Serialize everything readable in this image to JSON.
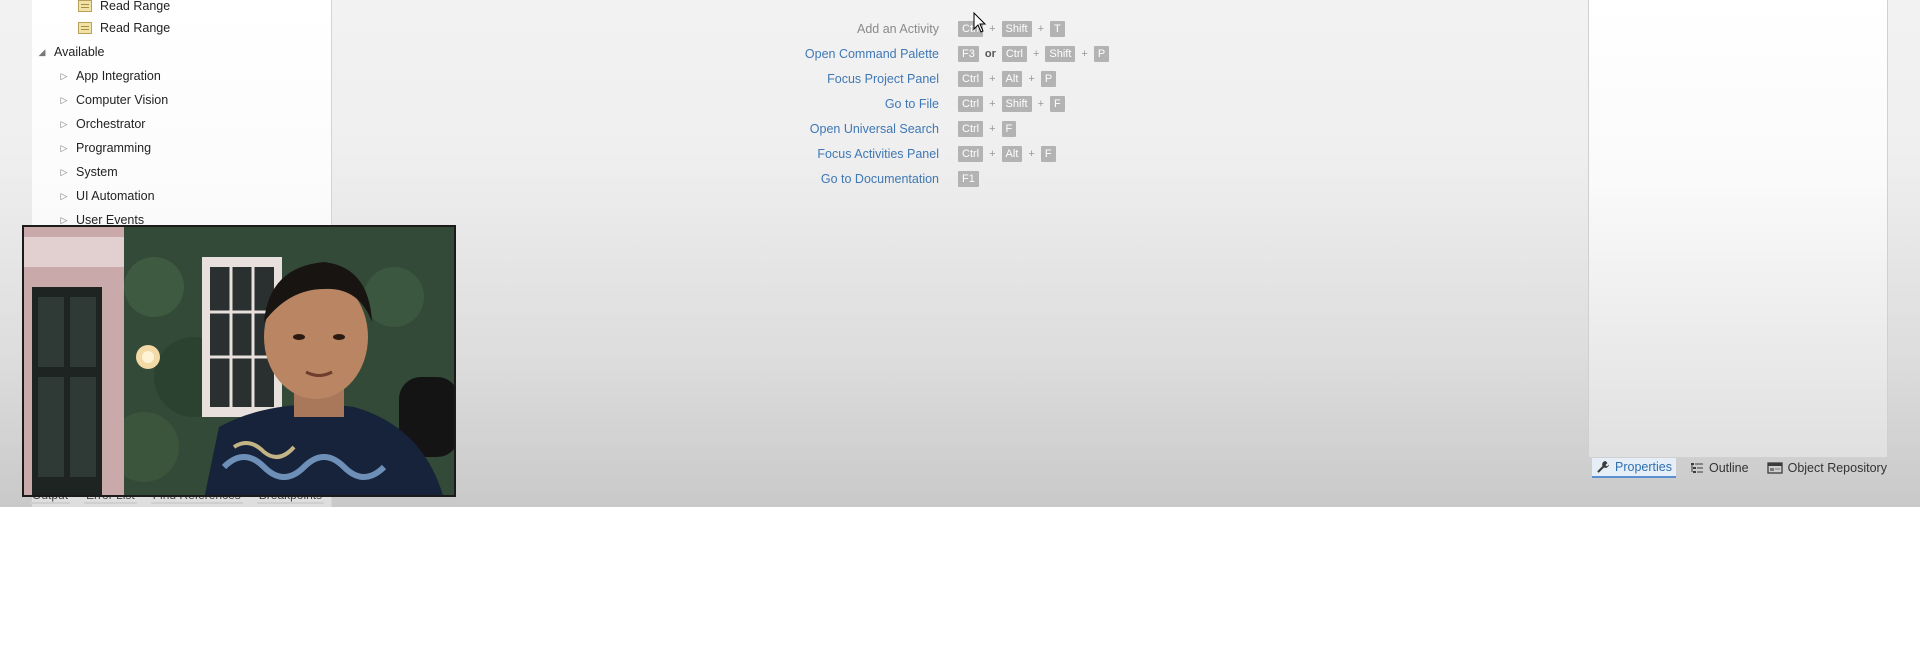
{
  "tree": {
    "items": [
      {
        "label": "Read Range",
        "kind": "activity"
      },
      {
        "label": "Read Range",
        "kind": "activity"
      },
      {
        "label": "Available",
        "kind": "group-expanded"
      },
      {
        "label": "App Integration",
        "kind": "category"
      },
      {
        "label": "Computer Vision",
        "kind": "category"
      },
      {
        "label": "Orchestrator",
        "kind": "category"
      },
      {
        "label": "Programming",
        "kind": "category"
      },
      {
        "label": "System",
        "kind": "category"
      },
      {
        "label": "UI Automation",
        "kind": "category"
      },
      {
        "label": "User Events",
        "kind": "category"
      }
    ]
  },
  "bottom_tabs": [
    "Output",
    "Error List",
    "Find References",
    "Breakpoints"
  ],
  "shortcuts": [
    {
      "label": "Add an Activity",
      "keys": [
        "Ctrl",
        "+",
        "Shift",
        "+",
        "T"
      ]
    },
    {
      "label": "Open Command Palette",
      "keys": [
        "F3",
        "or",
        "Ctrl",
        "+",
        "Shift",
        "+",
        "P"
      ]
    },
    {
      "label": "Focus Project Panel",
      "keys": [
        "Ctrl",
        "+",
        "Alt",
        "+",
        "P"
      ]
    },
    {
      "label": "Go to File",
      "keys": [
        "Ctrl",
        "+",
        "Shift",
        "+",
        "F"
      ]
    },
    {
      "label": "Open Universal Search",
      "keys": [
        "Ctrl",
        "+",
        "F"
      ]
    },
    {
      "label": "Focus Activities Panel",
      "keys": [
        "Ctrl",
        "+",
        "Alt",
        "+",
        "F"
      ]
    },
    {
      "label": "Go to Documentation",
      "keys": [
        "F1"
      ]
    }
  ],
  "right_tabs": {
    "properties": "Properties",
    "outline": "Outline",
    "object_repository": "Object Repository"
  },
  "icons": {
    "tree_collapsed": "triangle-right-icon",
    "tree_expanded": "triangle-down-icon",
    "activity": "read-range-icon",
    "properties": "wrench-icon",
    "outline": "outline-list-icon",
    "object_repository": "object-repository-icon",
    "cursor": "mouse-cursor-icon"
  },
  "colors": {
    "link_blue": "#3f78b5",
    "muted_text": "#8a8a8a",
    "key_bg": "#b3b3b3",
    "active_tab": "#2f6fb0"
  }
}
